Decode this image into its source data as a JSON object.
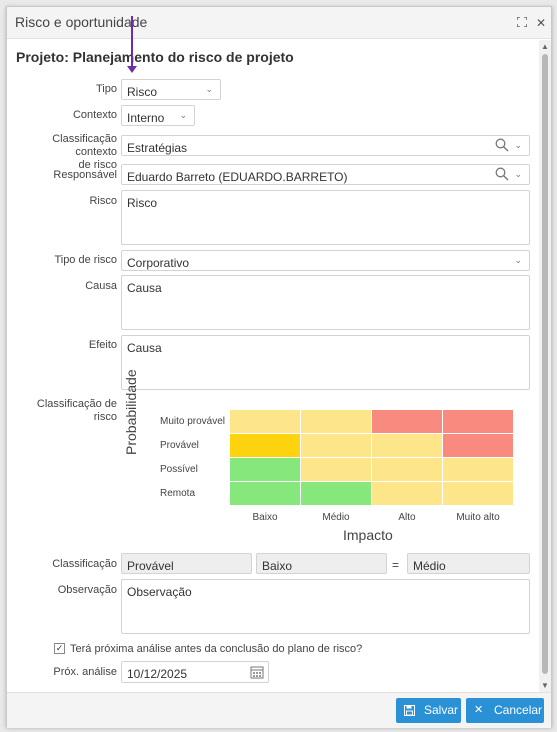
{
  "window": {
    "title": "Risco e oportunidade"
  },
  "project": {
    "title": "Projeto: Planejamento do risco de projeto"
  },
  "form": {
    "tipo": {
      "label": "Tipo",
      "value": "Risco"
    },
    "contexto": {
      "label": "Contexto",
      "value": "Interno"
    },
    "classificacao_contexto": {
      "label_line1": "Classificação contexto",
      "label_line2": "de risco",
      "value": "Estratégias"
    },
    "responsavel": {
      "label": "Responsável",
      "value": "Eduardo Barreto (EDUARDO.BARRETO)"
    },
    "risco": {
      "label": "Risco",
      "value": "Risco"
    },
    "tipo_risco": {
      "label": "Tipo de risco",
      "value": "Corporativo"
    },
    "causa": {
      "label": "Causa",
      "value": "Causa"
    },
    "efeito": {
      "label": "Efeito",
      "value": "Causa"
    },
    "classificacao_risco": {
      "label": "Classificação de risco"
    },
    "classificacao": {
      "label": "Classificação",
      "probabilidade": "Provável",
      "impacto": "Baixo",
      "equals": "=",
      "resultado": "Médio"
    },
    "observacao": {
      "label": "Observação",
      "value": "Observação"
    },
    "proxima_analise_check": {
      "label": "Terá próxima análise antes da conclusão do plano de risco?",
      "checked": true
    },
    "prox_analise": {
      "label": "Próx. análise",
      "value": "10/12/2025"
    }
  },
  "matrix": {
    "y_title": "Probabilidade",
    "x_title": "Impacto",
    "rows": [
      "Muito provável",
      "Provável",
      "Possível",
      "Remota"
    ],
    "cols": [
      "Baixo",
      "Médio",
      "Alto",
      "Muito alto"
    ],
    "colors": {
      "yellow": "#fde68a",
      "red": "#f88a80",
      "green": "#86e77c",
      "gold": "#fdd20e"
    },
    "cells": [
      [
        "yellow",
        "yellow",
        "red",
        "red"
      ],
      [
        "gold",
        "yellow",
        "yellow",
        "red"
      ],
      [
        "green",
        "yellow",
        "yellow",
        "yellow"
      ],
      [
        "green",
        "green",
        "yellow",
        "yellow"
      ]
    ]
  },
  "footer": {
    "save_label": "Salvar",
    "cancel_label": "Cancelar"
  },
  "icons": {
    "maximize": "maximize-icon",
    "close": "close-icon",
    "search": "search-icon",
    "chevron": "chevron-down-icon",
    "calendar": "calendar-icon",
    "save": "save-icon",
    "cancel": "x-icon"
  }
}
